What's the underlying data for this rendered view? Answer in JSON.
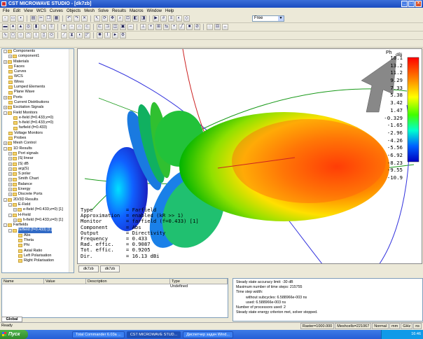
{
  "window": {
    "title": "CST MICROWAVE STUDIO - [dk7zb]"
  },
  "menu": [
    "File",
    "Edit",
    "View",
    "WCS",
    "Curves",
    "Objects",
    "Mesh",
    "Solve",
    "Results",
    "Macros",
    "Window",
    "Help"
  ],
  "toolbar": {
    "mode_select": "Free"
  },
  "tree": [
    {
      "label": "Components",
      "d": 0,
      "exp": "-"
    },
    {
      "label": "component1",
      "d": 1,
      "exp": "+"
    },
    {
      "label": "Materials",
      "d": 0,
      "exp": "+"
    },
    {
      "label": "Faces",
      "d": 0,
      "exp": ""
    },
    {
      "label": "Curves",
      "d": 0,
      "exp": ""
    },
    {
      "label": "WCS",
      "d": 0,
      "exp": ""
    },
    {
      "label": "Wires",
      "d": 0,
      "exp": ""
    },
    {
      "label": "Lumped Elements",
      "d": 0,
      "exp": ""
    },
    {
      "label": "Plane Wave",
      "d": 0,
      "exp": ""
    },
    {
      "label": "Ports",
      "d": 0,
      "exp": "+"
    },
    {
      "label": "Current Distributions",
      "d": 0,
      "exp": ""
    },
    {
      "label": "Excitation Signals",
      "d": 0,
      "exp": "+"
    },
    {
      "label": "Field Monitors",
      "d": 0,
      "exp": "-"
    },
    {
      "label": "e-field (f=0.433;z=0)",
      "d": 1,
      "exp": ""
    },
    {
      "label": "h-field (f=0.433;z=0)",
      "d": 1,
      "exp": ""
    },
    {
      "label": "farfield (f=0.433)",
      "d": 1,
      "exp": ""
    },
    {
      "label": "Voltage Monitors",
      "d": 0,
      "exp": ""
    },
    {
      "label": "Probes",
      "d": 0,
      "exp": ""
    },
    {
      "label": "Mesh Control",
      "d": 0,
      "exp": "+"
    },
    {
      "label": "1D Results",
      "d": 0,
      "exp": "-"
    },
    {
      "label": "Port signals",
      "d": 1,
      "exp": "+"
    },
    {
      "label": "|S| linear",
      "d": 1,
      "exp": "+"
    },
    {
      "label": "|S| dB",
      "d": 1,
      "exp": "+"
    },
    {
      "label": "arg(S)",
      "d": 1,
      "exp": "+"
    },
    {
      "label": "S polar",
      "d": 1,
      "exp": "+"
    },
    {
      "label": "Smith Chart",
      "d": 1,
      "exp": "+"
    },
    {
      "label": "Balance",
      "d": 1,
      "exp": "+"
    },
    {
      "label": "Energy",
      "d": 1,
      "exp": "+"
    },
    {
      "label": "Discrete Ports",
      "d": 1,
      "exp": "+"
    },
    {
      "label": "2D/3D Results",
      "d": 0,
      "exp": "-"
    },
    {
      "label": "E-Field",
      "d": 1,
      "exp": "-"
    },
    {
      "label": "e-field (f=0.433;z=0) [1]",
      "d": 2,
      "exp": "+"
    },
    {
      "label": "H-Field",
      "d": 1,
      "exp": "-"
    },
    {
      "label": "h-field (f=0.433;z=0) [1]",
      "d": 2,
      "exp": "+"
    },
    {
      "label": "Farfields",
      "d": 0,
      "exp": "-"
    },
    {
      "label": "farfield (f=0.433) [1]",
      "d": 1,
      "exp": "-",
      "sel": true
    },
    {
      "label": "Abs",
      "d": 2,
      "exp": ""
    },
    {
      "label": "Theta",
      "d": 2,
      "exp": ""
    },
    {
      "label": "Phi",
      "d": 2,
      "exp": ""
    },
    {
      "label": "Axial Ratio",
      "d": 2,
      "exp": ""
    },
    {
      "label": "Left Polarisation",
      "d": 2,
      "exp": ""
    },
    {
      "label": "Right Polarisation",
      "d": 2,
      "exp": ""
    }
  ],
  "farfield_info": [
    {
      "k": "Type",
      "v": "= Farfield"
    },
    {
      "k": "Approximation",
      "v": "= enabled (kR >> 1)"
    },
    {
      "k": "Monitor",
      "v": "= farfield (f=0.433) [1]"
    },
    {
      "k": "Component",
      "v": "= Abs"
    },
    {
      "k": "Output",
      "v": "= Directivity"
    },
    {
      "k": "Frequency",
      "v": "= 0.433"
    },
    {
      "k": "Rad. effic.",
      "v": "= 0.9087"
    },
    {
      "k": "Tot. effic.",
      "v": "= 0.9205"
    },
    {
      "k": "Dir.",
      "v": "= 16.13 dBi"
    }
  ],
  "colorbar": {
    "axis_label": "Ph",
    "unit": "dBi",
    "ticks": [
      "16.1",
      "13.2",
      "11.2",
      "9.29",
      "7.33",
      "5.38",
      "3.42",
      "1.47",
      "-0.329",
      "-1.65",
      "-2.96",
      "-4.26",
      "-5.56",
      "-6.92",
      "-8.23",
      "-9.55",
      "-10.9"
    ]
  },
  "view_tabs": [
    "dk7zb",
    "dk7zb"
  ],
  "params": {
    "columns": [
      "Name",
      "Value",
      "Description",
      "Type"
    ],
    "row_type": "Undefined",
    "tab": "Global"
  },
  "messages": [
    {
      "t": "Steady state accuracy limit: -30 dB",
      "ind": false
    },
    {
      "t": "Maximum number of time steps: 215755",
      "ind": false
    },
    {
      "t": "Time step width:",
      "ind": false
    },
    {
      "t": "without subcycles: 6.588966e-003 ns",
      "ind": true
    },
    {
      "t": "used: 6.588966e-003 ns",
      "ind": true
    },
    {
      "t": "Number of processors used: 2",
      "ind": false
    },
    {
      "t": "Steady state energy criterion met, solver stopped.",
      "ind": false
    }
  ],
  "status": {
    "left": "Ready",
    "cells": [
      "Raster=1000.000",
      "Meshcells=221067",
      "Normal",
      "mm",
      "GHz",
      "ns"
    ]
  },
  "taskbar": {
    "start": "Пуск",
    "tasks": [
      "Total Commander 6.03a ...",
      "CST MICROWAVE STUD...",
      "Диспетчер задач Wind..."
    ],
    "clock": "16:46"
  }
}
